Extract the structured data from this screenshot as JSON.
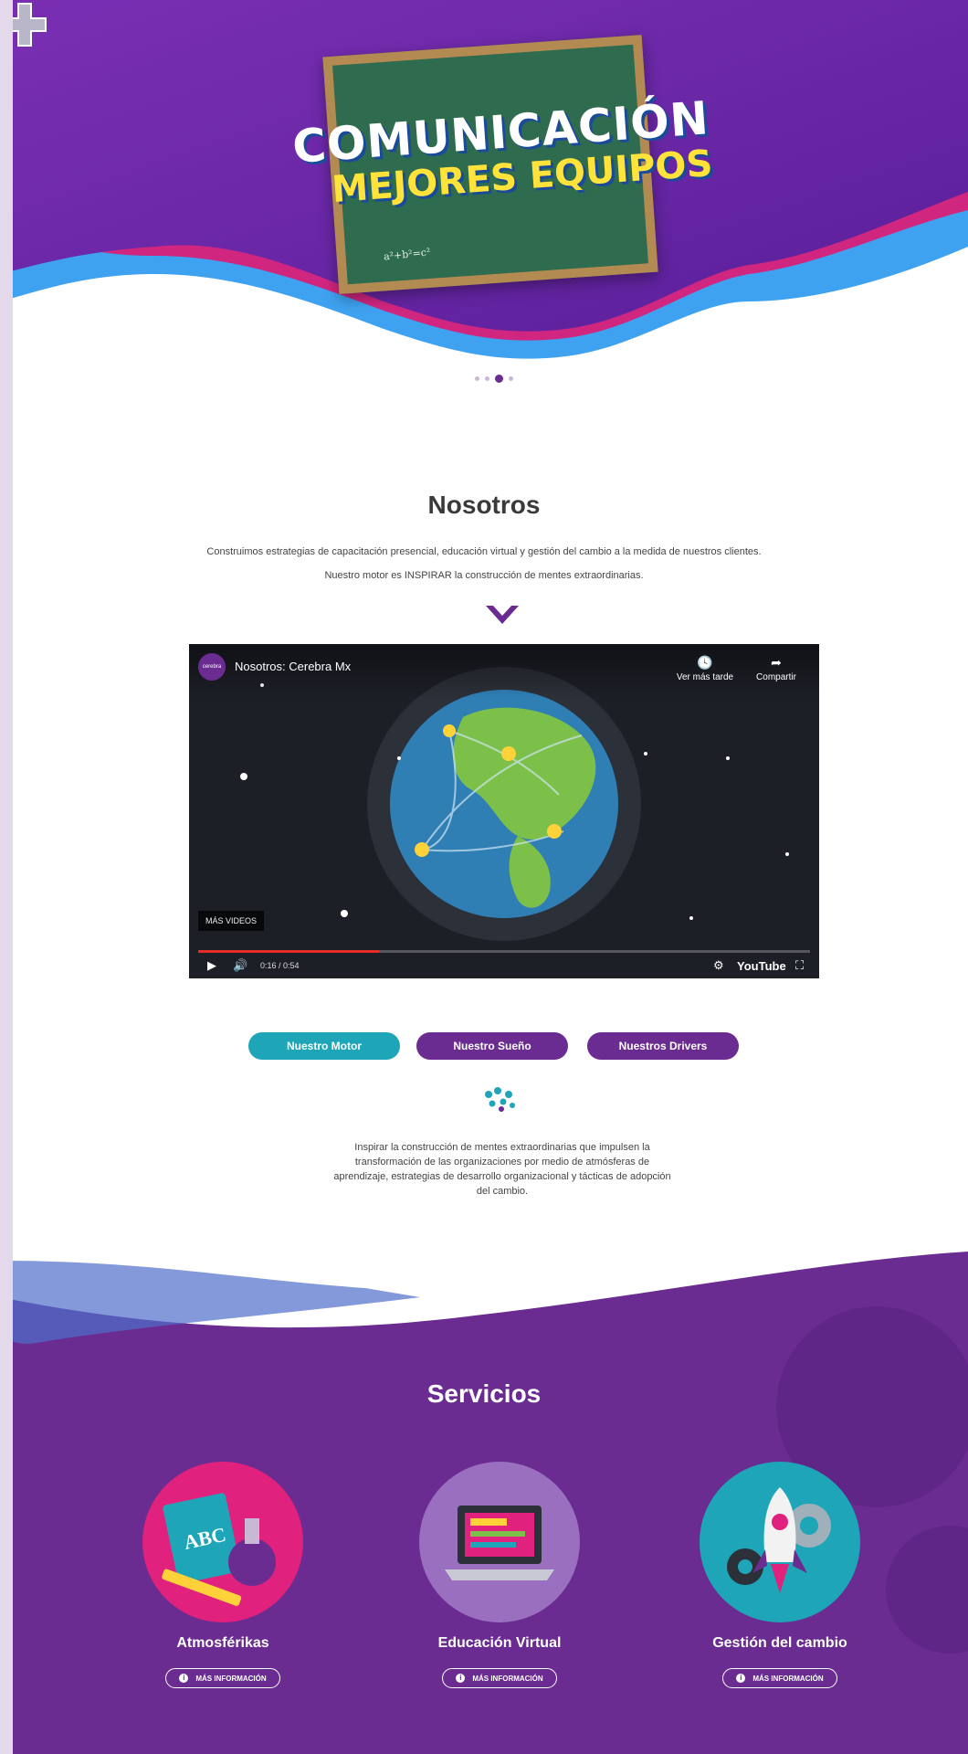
{
  "hero": {
    "line1": "COMUNICACIÓN",
    "line2": "MEJORES EQUIPOS",
    "formula": "a²+b²=c²",
    "slides_total": 4,
    "slide_active": 3
  },
  "nosotros": {
    "title": "Nosotros",
    "paragraph1": "Construimos estrategias de capacitación presencial, educación virtual y gestión del cambio a la medida de nuestros clientes.",
    "paragraph2": "Nuestro motor es INSPIRAR la construcción de mentes extraordinarias."
  },
  "video": {
    "channel": "cerebra",
    "title": "Nosotros: Cerebra Mx",
    "watch_later": "Ver más tarde",
    "share": "Compartir",
    "more_videos": "MÁS VIDEOS",
    "time": "0:16 / 0:54",
    "progress": 0.296,
    "brand": "YouTube"
  },
  "tabs": [
    {
      "label": "Nuestro Motor",
      "active": true
    },
    {
      "label": "Nuestro Sueño",
      "active": false
    },
    {
      "label": "Nuestros Drivers",
      "active": false
    }
  ],
  "motor_text": "Inspirar la construcción de mentes extraordinarias que impulsen la transformación de las organizaciones por medio de atmósferas de aprendizaje, estrategias de desarrollo organizacional y tácticas de adopción del cambio.",
  "servicios": {
    "title": "Servicios",
    "more_label": "MÁS INFORMACIÓN",
    "items": [
      {
        "name": "Atmosférikas",
        "icon": "abc-book-flask-icon",
        "color": "#e0217d"
      },
      {
        "name": "Educación Virtual",
        "icon": "laptop-icon",
        "color": "#9a6fc0"
      },
      {
        "name": "Gestión del cambio",
        "icon": "rocket-gears-icon",
        "color": "#1ea6b8"
      }
    ],
    "book_text": "ABC"
  },
  "colors": {
    "purple": "#6a2c91",
    "teal": "#1ea6b8",
    "magenta": "#e0217d",
    "blue_wave": "#3fa2f0"
  }
}
